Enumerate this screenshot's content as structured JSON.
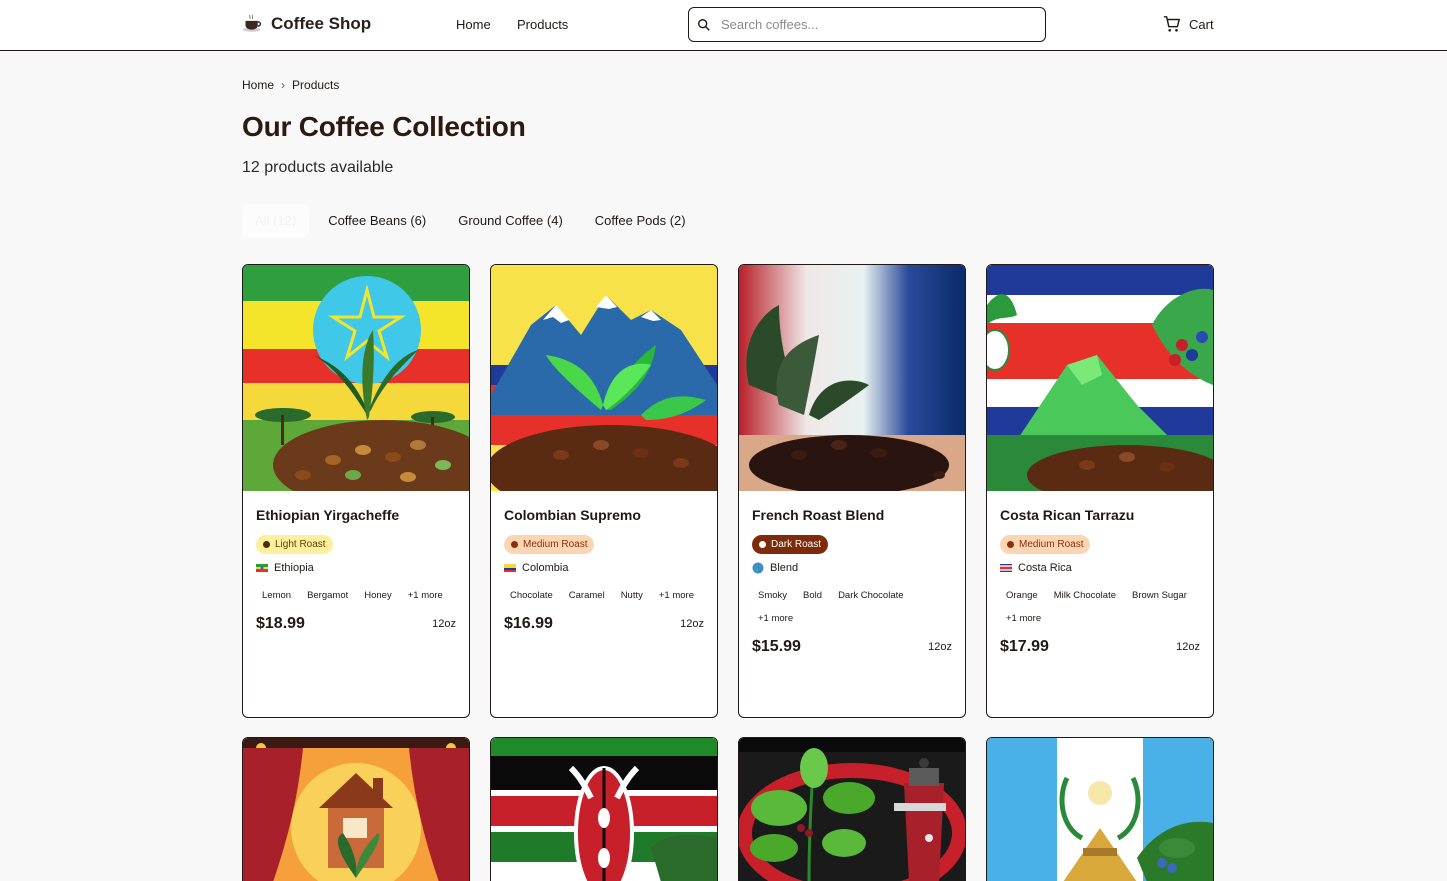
{
  "header": {
    "logo_text": "Coffee Shop",
    "nav": [
      "Home",
      "Products"
    ],
    "search_placeholder": "Search coffees...",
    "cart_label": "Cart"
  },
  "breadcrumb": [
    "Home",
    "Products"
  ],
  "page": {
    "title": "Our Coffee Collection",
    "subtitle": "12 products available"
  },
  "tabs": [
    {
      "label": "All (12)",
      "active": true
    },
    {
      "label": "Coffee Beans (6)",
      "active": false
    },
    {
      "label": "Ground Coffee (4)",
      "active": false
    },
    {
      "label": "Coffee Pods (2)",
      "active": false
    }
  ],
  "products": [
    {
      "name": "Ethiopian Yirgacheffe",
      "roast": "Light Roast",
      "roast_level": "light",
      "origin": "Ethiopia",
      "origin_icon": "ethiopia-flag-icon",
      "notes": [
        "Lemon",
        "Bergamot",
        "Honey",
        "+1 more"
      ],
      "price": "$18.99",
      "size": "12oz"
    },
    {
      "name": "Colombian Supremo",
      "roast": "Medium Roast",
      "roast_level": "medium",
      "origin": "Colombia",
      "origin_icon": "colombia-flag-icon",
      "notes": [
        "Chocolate",
        "Caramel",
        "Nutty",
        "+1 more"
      ],
      "price": "$16.99",
      "size": "12oz"
    },
    {
      "name": "French Roast Blend",
      "roast": "Dark Roast",
      "roast_level": "dark",
      "origin": "Blend",
      "origin_icon": "globe-icon",
      "notes": [
        "Smoky",
        "Bold",
        "Dark Chocolate",
        "+1 more"
      ],
      "price": "$15.99",
      "size": "12oz"
    },
    {
      "name": "Costa Rican Tarrazu",
      "roast": "Medium Roast",
      "roast_level": "medium",
      "origin": "Costa Rica",
      "origin_icon": "costa-rica-flag-icon",
      "notes": [
        "Orange",
        "Milk Chocolate",
        "Brown Sugar",
        "+1 more"
      ],
      "price": "$17.99",
      "size": "12oz"
    }
  ],
  "colors": {
    "accent_dark": "#2b1a12",
    "light_roast_bg": "#fdef9e",
    "medium_roast_bg": "#fcd6b4",
    "dark_roast_bg": "#7e2b0c"
  }
}
